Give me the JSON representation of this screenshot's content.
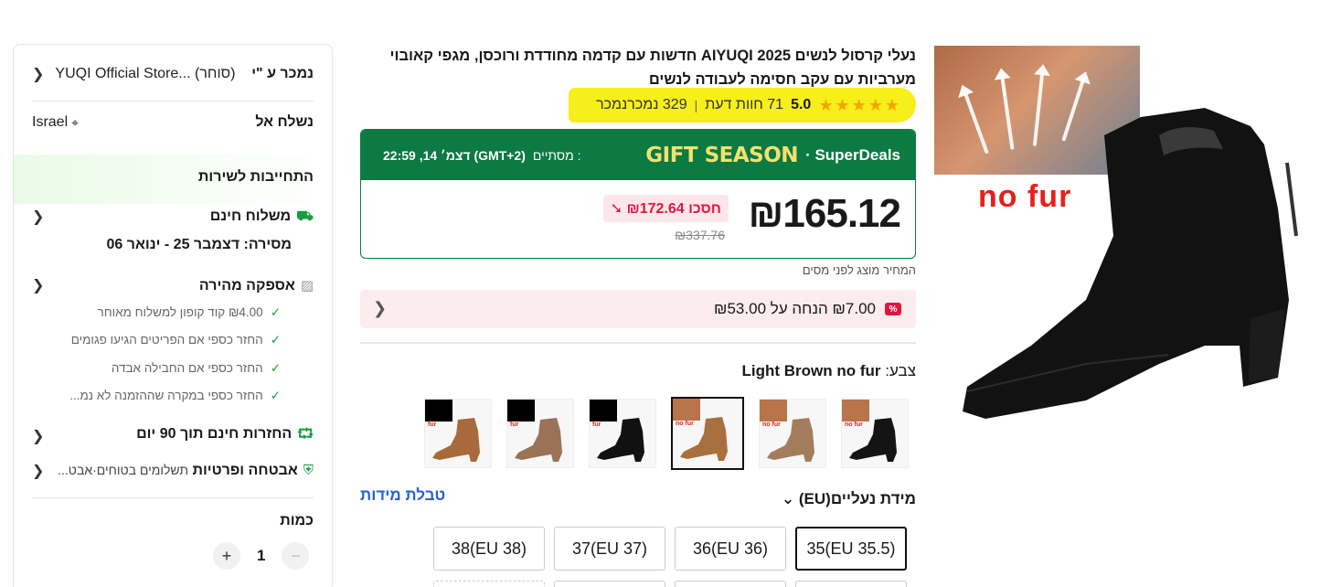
{
  "seller": {
    "label": "נמכר ע \"י",
    "store": "YUQI Official Store... (סוחר)"
  },
  "ship_to": {
    "label": "נשלח אל",
    "country": "Israel"
  },
  "service": {
    "heading": "התחייבות לשירות",
    "free_shipping": "משלוח חינם",
    "delivery": "מסירה: דצמבר 25 - ינואר 06",
    "fast_delivery": "אספקה מהירה",
    "checks": [
      "₪4.00 קוד קופון למשלוח מאוחר",
      "החזר כספי אם הפריטים הגיעו פגומים",
      "החזר כספי אם החבילה אבדה",
      "החזר כספי במקרה שההזמנה לא נמ..."
    ],
    "returns": "החזרות חינם תוך 90 יום",
    "security": "אבטחה ופרטיות",
    "security_sub": "תשלומים בטוחים·אבט..."
  },
  "quantity": {
    "label": "כמות",
    "value": "1",
    "minus": "−",
    "plus": "+"
  },
  "product": {
    "title": "נעלי קרסול לנשים AIYUQI 2025 חדשות עם קדמה מחודדת ורוכסן, מגפי קאובוי מערביות עם עקב חסימה לעבודה לנשים",
    "rating": "5.0",
    "stars": "★★★★★",
    "reviews": "71 חוות דעת",
    "sold": "329 נמכרנמכר",
    "rating_sep": "|"
  },
  "deal": {
    "brand": "SuperDeals",
    "season": "GIFT SEASON",
    "ends_label": "מסתיים :",
    "ends_time": "דצמ׳ 14, 22:59 (GMT+2)",
    "price": "₪165.12",
    "save": "₪172.64 חסכו",
    "original": "₪337.76"
  },
  "tax_note": "המחיר מוצג לפני מסים",
  "coupon": {
    "text": "₪7.00 הנחה על ₪53.00",
    "badge": "%"
  },
  "color": {
    "label": "צבע:",
    "value": "Light Brown no fur",
    "swatches": [
      {
        "tag": "fur",
        "boot": "#a86a3a",
        "mini": "#000000"
      },
      {
        "tag": "fur",
        "boot": "#9a7256",
        "mini": "#000000"
      },
      {
        "tag": "fur",
        "boot": "#111111",
        "mini": "#000000"
      },
      {
        "tag": "no fur",
        "boot": "#a8703f",
        "mini": "#b9744a"
      },
      {
        "tag": "no fur",
        "boot": "#a37c5c",
        "mini": "#b9744a"
      },
      {
        "tag": "no fur",
        "boot": "#141414",
        "mini": "#b9744a"
      }
    ]
  },
  "size": {
    "label": "מידת נעליים(EU)",
    "chart": "טבלת מידות",
    "options": [
      "38(EU 38)",
      "37(EU 37)",
      "36(EU 36)",
      "35(EU 35.5)"
    ]
  },
  "gallery": {
    "caption": "no fur"
  }
}
